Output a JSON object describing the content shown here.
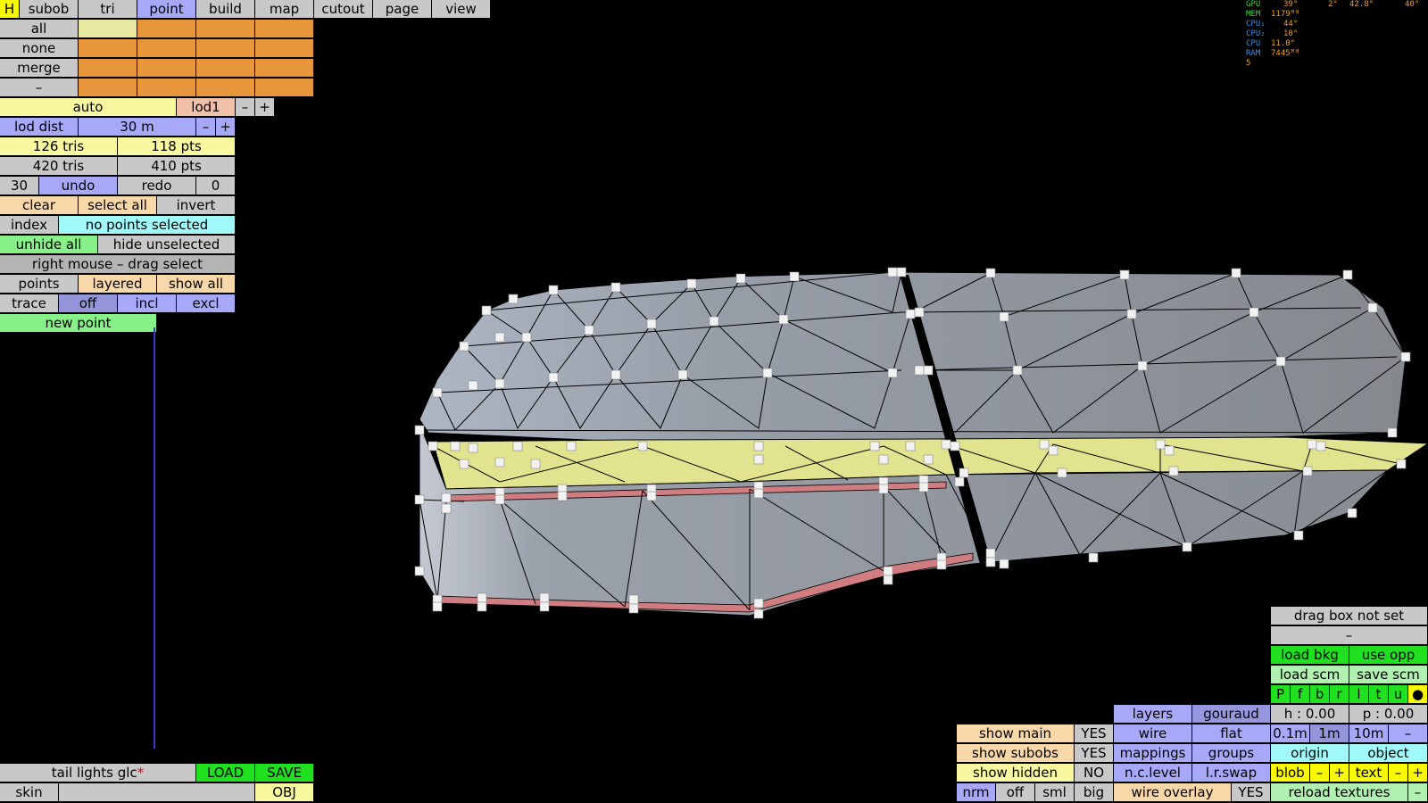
{
  "stats": {
    "gpu_label": "GPU",
    "gpu_temp": "39°",
    "gpu_load": "2°",
    "gpu_clock": "42.8°",
    "gpu_extra": "40°",
    "mem_label": "MEM",
    "mem_value": "1179ᴹᴮ",
    "cpu1_label": "CPU₁",
    "cpu1_value": "44°",
    "cpu2_label": "CPU₂",
    "cpu2_value": "10°",
    "cpu_label": "CPU",
    "cpu_value": "11.0°",
    "ram_label": "RAM",
    "ram_value": "7445ᴹᴮ",
    "fps": "5",
    "colors": {
      "green": "#40d040",
      "blue": "#3890e8",
      "orange": "#f0a020"
    }
  },
  "menu": {
    "home": "H",
    "tabs": [
      "subob",
      "tri",
      "point",
      "build",
      "map",
      "cutout",
      "page",
      "view"
    ],
    "active_tab": "point"
  },
  "selection": {
    "rows": [
      "all",
      "none",
      "merge",
      "–"
    ]
  },
  "lod": {
    "mode": "auto",
    "level": "lod1",
    "minus": "–",
    "plus": "+",
    "dist_label": "lod dist",
    "dist_value": "30 m",
    "tris_lod": "126 tris",
    "pts_lod": "118 pts",
    "tris_total": "420 tris",
    "pts_total": "410 pts"
  },
  "history": {
    "count": "30",
    "undo": "undo",
    "redo": "redo",
    "redo_count": "0"
  },
  "actions": {
    "clear": "clear",
    "select_all": "select all",
    "invert": "invert",
    "index": "index",
    "status": "no points selected",
    "unhide_all": "unhide all",
    "hide_unselected": "hide unselected",
    "hint": "right mouse – drag select",
    "points": "points",
    "layered": "layered",
    "show_all": "show all",
    "trace": "trace",
    "trace_off": "off",
    "trace_incl": "incl",
    "trace_excl": "excl",
    "new_point": "new point"
  },
  "file": {
    "name": "tail lights glc",
    "modified_mark": "*",
    "load": "LOAD",
    "save": "SAVE",
    "skin": "skin",
    "skin_value": "",
    "obj": "OBJ"
  },
  "view_panel": {
    "drag_box": "drag box not set",
    "dash": "–",
    "load_bkg": "load bkg",
    "use_opp": "use opp",
    "load_scm": "load scm",
    "save_scm": "save scm",
    "views": [
      "P",
      "f",
      "b",
      "r",
      "l",
      "t",
      "u",
      "●"
    ],
    "h": "h : 0.00",
    "p": "p : 0.00",
    "steps": [
      "0.1m",
      "1m",
      "10m",
      "–"
    ],
    "origin": "origin",
    "object": "object",
    "blob": "blob",
    "blob_minus": "–",
    "blob_plus": "+",
    "text": "text",
    "text_minus": "–",
    "text_plus": "+",
    "reload_textures": "reload textures",
    "reload_extra": "–"
  },
  "render_panel": {
    "layers": "layers",
    "gouraud": "gouraud",
    "wire": "wire",
    "flat": "flat",
    "mappings": "mappings",
    "groups": "groups",
    "nc_level": "n.c.level",
    "lr_swap": "l.r.swap",
    "wire_overlay": "wire overlay",
    "wire_overlay_value": "YES"
  },
  "show_panel": {
    "show_main": "show main",
    "show_main_value": "YES",
    "show_subobs": "show subobs",
    "show_subobs_value": "YES",
    "show_hidden": "show hidden",
    "show_hidden_value": "NO",
    "sizes": [
      "nrm",
      "off",
      "sml",
      "big"
    ]
  },
  "colors": {
    "mesh_side": "#9aa0ab",
    "mesh_top": "#8f949b",
    "band_yellow": "#e3e58f",
    "band_red": "#cf7d80",
    "vertex": "#f2f2f2",
    "edge": "#000000"
  }
}
